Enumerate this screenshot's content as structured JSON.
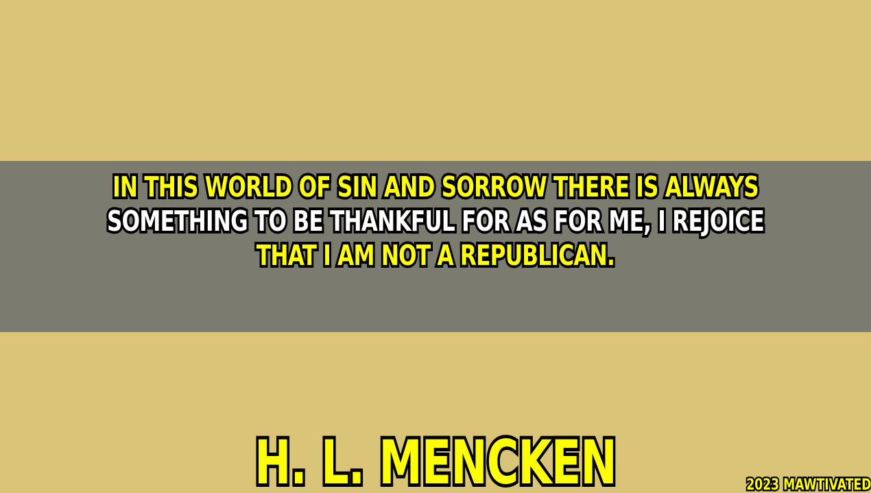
{
  "quote": {
    "lines": [
      "IN THIS WORLD OF SIN AND SORROW THERE IS ALWAYS",
      "SOMETHING TO BE THANKFUL FOR AS FOR ME, I REJOICE",
      "THAT I AM NOT A REPUBLICAN."
    ]
  },
  "author": "H. L. MENCKEN",
  "credit": "2023 MAWTIVATED",
  "colors": {
    "background": "#d9c478",
    "band": "#7b7b70",
    "yellow_text": "#ffff00",
    "white_text": "#ffffff",
    "outline": "#000000"
  }
}
